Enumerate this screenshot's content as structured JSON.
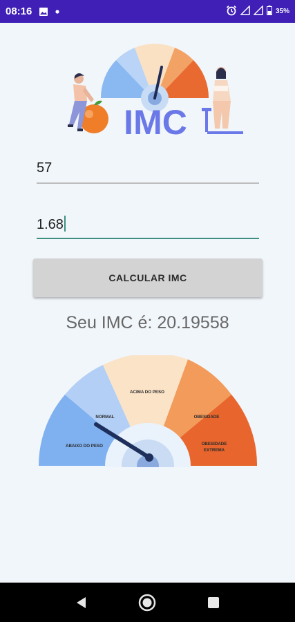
{
  "status": {
    "time": "08:16",
    "battery": "35%",
    "colors": {
      "bar": "#3f1fb5"
    },
    "icons": [
      "image-icon",
      "dot-icon",
      "alarm-icon",
      "signal-icon",
      "battery-icon"
    ]
  },
  "hero": {
    "title": "IMC"
  },
  "form": {
    "weight_value": "57",
    "height_value": "1.68"
  },
  "button": {
    "label": "CALCULAR IMC"
  },
  "result": {
    "text": "Seu IMC é: 20.19558"
  },
  "gauge": {
    "categories": [
      "ABAIXO DO PESO",
      "NORMAL",
      "ACIMA DO PESO",
      "OBESIDADE",
      "OBESIDADE EXTREMA"
    ],
    "extreme_line1": "OBESIDADE",
    "extreme_line2": "EXTREMA",
    "colors": [
      "#7fb0ef",
      "#b3cff5",
      "#fbe3c8",
      "#f29b5a",
      "#e8662d"
    ],
    "needle_category": "NORMAL"
  },
  "nav": {
    "icons": [
      "back-icon",
      "home-icon",
      "recents-icon"
    ]
  }
}
